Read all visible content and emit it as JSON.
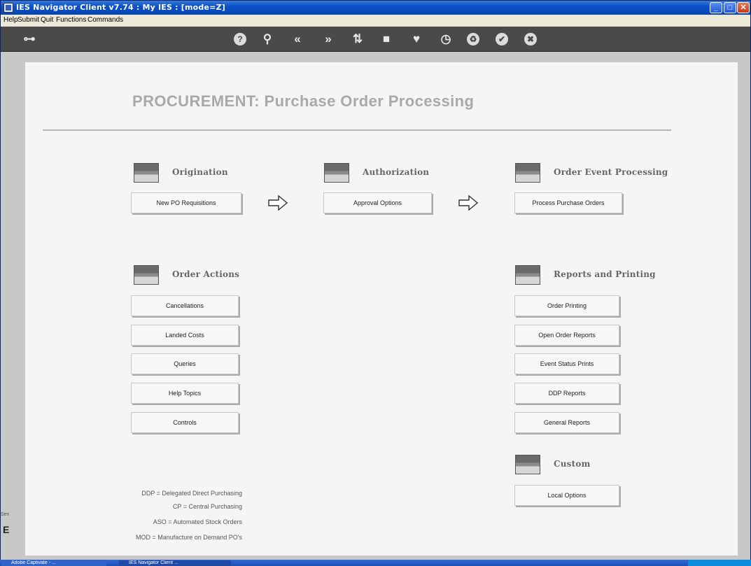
{
  "window": {
    "title": "IES Navigator Client v7.74 : My IES :      [mode=Z]",
    "minimize": "_",
    "maximize": "□",
    "close": "✕"
  },
  "menubar": [
    "Help",
    "Submit",
    "Quit",
    "Functions",
    "Commands"
  ],
  "toolbar": {
    "icons": [
      "key-icon",
      "help-icon",
      "search-icon",
      "rewind-icon",
      "fast-forward-icon",
      "sort-icon",
      "stop-icon",
      "heart-icon",
      "clock-icon",
      "refresh-icon",
      "check-icon",
      "close-icon"
    ],
    "glyphs": [
      "⊶",
      "?",
      "⚲",
      "«",
      "»",
      "⇅",
      "■",
      "♥",
      "◷",
      "♻",
      "✔",
      "✖"
    ]
  },
  "page": {
    "title": "PROCUREMENT: Purchase Order Processing"
  },
  "sections": {
    "origination": {
      "label": "Origination",
      "buttons": [
        "New PO Requisitions"
      ]
    },
    "authorization": {
      "label": "Authorization",
      "buttons": [
        "Approval Options"
      ]
    },
    "order_event": {
      "label": "Order Event Processing",
      "buttons": [
        "Process Purchase Orders"
      ]
    },
    "order_actions": {
      "label": "Order Actions",
      "buttons": [
        "Cancellations",
        "Landed Costs",
        "Queries",
        "Help Topics",
        "Controls"
      ]
    },
    "reports": {
      "label": "Reports and Printing",
      "buttons": [
        "Order Printing",
        "Open Order Reports",
        "Event Status Prints",
        "DDP Reports",
        "General Reports"
      ]
    },
    "custom": {
      "label": "Custom",
      "buttons": [
        "Local Options"
      ]
    }
  },
  "legend": [
    "DDP = Delegated Direct Purchasing",
    "CP = Central Purchasing",
    "ASO = Automated Stock Orders",
    "MOD = Manufacture on Demand PO's"
  ],
  "edge": {
    "char": "E",
    "small": "Sen"
  },
  "taskbar": {
    "items": [
      "Adobe Captivate - ...",
      "IES Navigator Client ..."
    ]
  },
  "colors": {
    "titlebar": "#0a52c8",
    "toolbar": "#4a4a4a",
    "panel": "#f5f5f5",
    "heading": "#a9a9a9"
  }
}
